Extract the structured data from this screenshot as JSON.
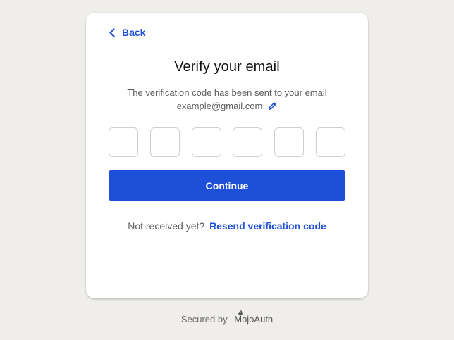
{
  "nav": {
    "back_label": "Back"
  },
  "verify": {
    "title": "Verify your email",
    "message": "The verification code has been sent to your email",
    "email": "example@gmail.com"
  },
  "code_inputs": [
    {
      "value": ""
    },
    {
      "value": ""
    },
    {
      "value": ""
    },
    {
      "value": ""
    },
    {
      "value": ""
    },
    {
      "value": ""
    }
  ],
  "actions": {
    "continue_label": "Continue",
    "resend_prompt": "Not received yet?",
    "resend_label": "Resend verification code"
  },
  "footer": {
    "secured_by": "Secured by",
    "brand": "MojoAuth"
  },
  "colors": {
    "accent": "#1d4fd8",
    "background": "#efeeeb"
  },
  "icons": {
    "back": "chevron-left-icon",
    "edit": "pencil-icon",
    "brand": "mojoauth-logo-icon"
  }
}
